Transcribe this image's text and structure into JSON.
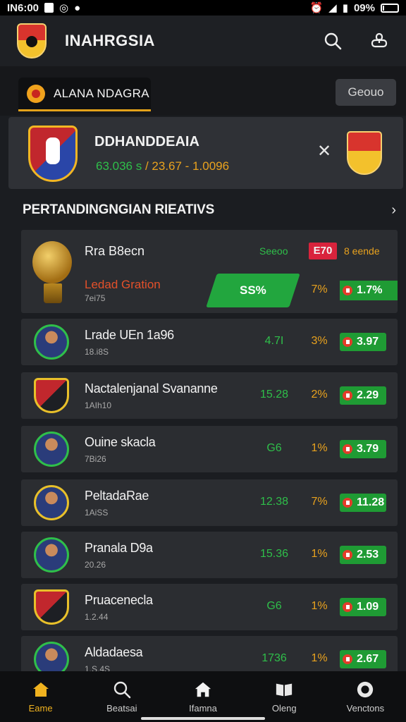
{
  "statusbar": {
    "time": "IN6:00",
    "battery": "09%"
  },
  "appbar": {
    "title": "INAHRGSIA"
  },
  "tabs": {
    "league_label": "ALANA NDAGRA",
    "group_label": "Geouo"
  },
  "match_card": {
    "title": "DDHANDDEAIA",
    "stat_a": "63.036 s",
    "stat_sep": " / ",
    "stat_b": "23.67 - 1.0096"
  },
  "section": {
    "title": "PERTANDINGNGIAN RIEATIVS"
  },
  "featured": {
    "name": "Rra B8ecn",
    "label": "Seeoo",
    "badge": "E70",
    "extra": "8 eende",
    "highlight": "Ledad Gration",
    "sub": "7ei75",
    "bar_value": "SS%",
    "pct": "7%",
    "pill": "1.7%"
  },
  "rows": [
    {
      "name": "Lrade UEn 1a96",
      "sub": "18.i8S",
      "odds": "4.7I",
      "pct": "3%",
      "pill": "3.97",
      "avatar": "player"
    },
    {
      "name": "Nactalenjanal Svananne",
      "sub": "1AIh10",
      "odds": "15.28",
      "pct": "2%",
      "pill": "2.29",
      "avatar": "shield"
    },
    {
      "name": "Ouine skacla",
      "sub": "7Bi26",
      "odds": "G6",
      "pct": "1%",
      "pill": "3.79",
      "avatar": "player"
    },
    {
      "name": "PeltadaRae",
      "sub": "1AiSS",
      "odds": "12.38",
      "pct": "7%",
      "pill": "11.28",
      "avatar": "yellow"
    },
    {
      "name": "Pranala D9a",
      "sub": "20.26",
      "odds": "15.36",
      "pct": "1%",
      "pill": "2.53",
      "avatar": "player"
    },
    {
      "name": "Pruacenecla",
      "sub": "1.2.44",
      "odds": "G6",
      "pct": "1%",
      "pill": "1.09",
      "avatar": "shield"
    },
    {
      "name": "Aldadaesa",
      "sub": "1.S.4S",
      "odds": "1736",
      "pct": "1%",
      "pill": "2.67",
      "avatar": "player"
    }
  ],
  "nav": [
    {
      "label": "Eame",
      "icon": "home-icon",
      "active": true
    },
    {
      "label": "Beatsai",
      "icon": "search-icon"
    },
    {
      "label": "Ifamna",
      "icon": "house-icon"
    },
    {
      "label": "Oleng",
      "icon": "book-icon"
    },
    {
      "label": "Venctons",
      "icon": "profile-icon"
    }
  ],
  "colors": {
    "accent": "#f0b21f",
    "positive": "#2fbf4a",
    "negative": "#d9233c",
    "warning": "#e9a21e"
  }
}
